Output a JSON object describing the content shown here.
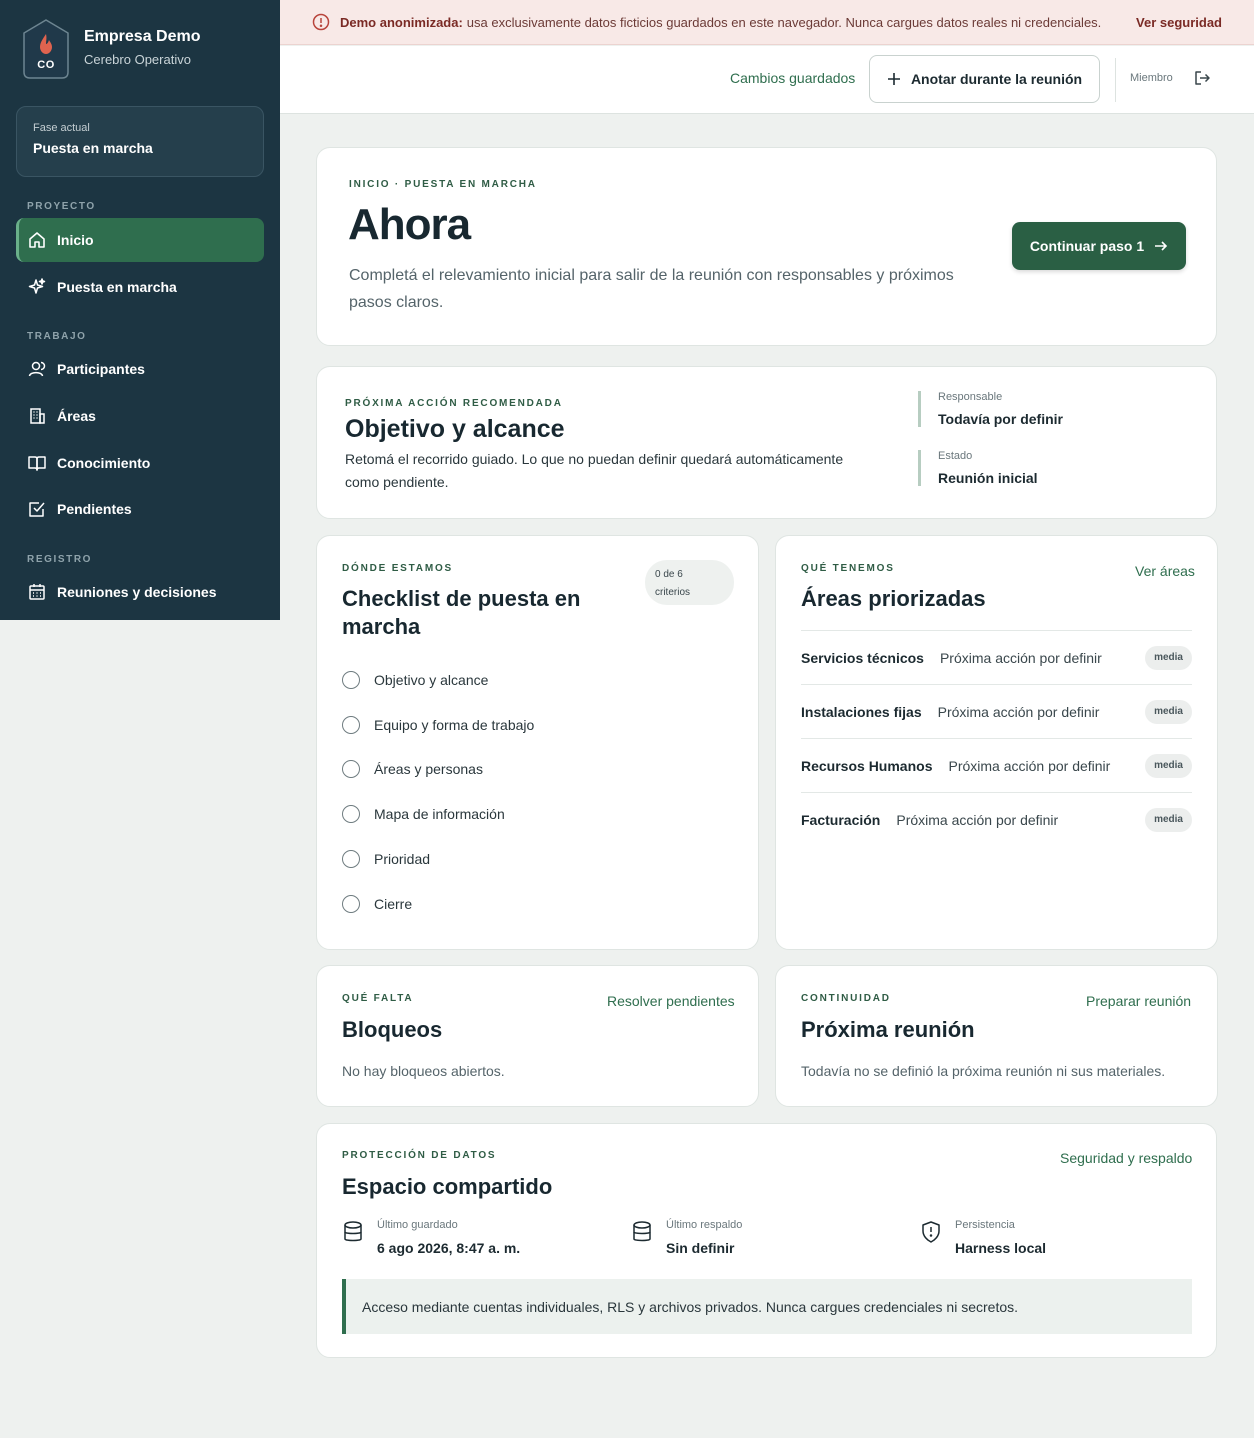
{
  "banner": {
    "bold": "Demo anonimizada:",
    "text": "usa exclusivamente datos ficticios guardados en este navegador. Nunca cargues datos reales ni credenciales.",
    "link": "Ver seguridad"
  },
  "brand": {
    "initials": "CO",
    "name": "Empresa Demo",
    "subtitle": "Cerebro Operativo"
  },
  "phase": {
    "label": "Fase actual",
    "value": "Puesta en marcha"
  },
  "sidebar": {
    "sections": [
      {
        "label": "PROYECTO",
        "items": [
          {
            "label": "Inicio",
            "icon": "home-icon",
            "active": true
          },
          {
            "label": "Puesta en marcha",
            "icon": "sparkles-icon"
          }
        ]
      },
      {
        "label": "TRABAJO",
        "items": [
          {
            "label": "Participantes",
            "icon": "user-icon"
          },
          {
            "label": "Áreas",
            "icon": "building-icon"
          },
          {
            "label": "Conocimiento",
            "icon": "book-icon"
          },
          {
            "label": "Pendientes",
            "icon": "checkbox-icon"
          }
        ]
      },
      {
        "label": "REGISTRO",
        "items": [
          {
            "label": "Reuniones y decisiones",
            "icon": "calendar-icon"
          }
        ]
      }
    ]
  },
  "topbar": {
    "saved": "Cambios guardados",
    "annotate": "Anotar durante la reunión",
    "role": "Miembro"
  },
  "hero": {
    "kicker": "INICIO · PUESTA EN MARCHA",
    "title": "Ahora",
    "description": "Completá el relevamiento inicial para salir de la reunión con responsables y próximos pasos claros.",
    "cta": "Continuar paso 1"
  },
  "next_action": {
    "kicker": "PRÓXIMA ACCIÓN RECOMENDADA",
    "title": "Objetivo y alcance",
    "description": "Retomá el recorrido guiado. Lo que no puedan definir quedará automáticamente como pendiente.",
    "owner_label": "Responsable",
    "owner_value": "Todavía por definir",
    "status_label": "Estado",
    "status_value": "Reunión inicial"
  },
  "checklist": {
    "kicker": "DÓNDE ESTAMOS",
    "title": "Checklist de puesta en marcha",
    "pill_line1": "0 de 6",
    "pill_line2": "criterios",
    "items": [
      "Objetivo y alcance",
      "Equipo y forma de trabajo",
      "Áreas y personas",
      "Mapa de información",
      "Prioridad",
      "Cierre"
    ]
  },
  "areas": {
    "kicker": "QUÉ TENEMOS",
    "title": "Áreas priorizadas",
    "link": "Ver áreas",
    "rows": [
      {
        "name": "Servicios técnicos",
        "action": "Próxima acción por definir",
        "badge": "media"
      },
      {
        "name": "Instalaciones fijas",
        "action": "Próxima acción por definir",
        "badge": "media"
      },
      {
        "name": "Recursos Humanos",
        "action": "Próxima acción por definir",
        "badge": "media"
      },
      {
        "name": "Facturación",
        "action": "Próxima acción por definir",
        "badge": "media"
      }
    ]
  },
  "blocks": {
    "kicker": "QUÉ FALTA",
    "title": "Bloqueos",
    "link": "Resolver pendientes",
    "description": "No hay bloqueos abiertos."
  },
  "meeting": {
    "kicker": "CONTINUIDAD",
    "title": "Próxima reunión",
    "link": "Preparar reunión",
    "description": "Todavía no se definió la próxima reunión ni sus materiales."
  },
  "data_protection": {
    "kicker": "PROTECCIÓN DE DATOS",
    "title": "Espacio compartido",
    "link": "Seguridad y respaldo",
    "items": [
      {
        "label": "Último guardado",
        "value": "6 ago 2026, 8:47 a. m.",
        "icon": "database-icon"
      },
      {
        "label": "Último respaldo",
        "value": "Sin definir",
        "icon": "database-icon"
      },
      {
        "label": "Persistencia",
        "value": "Harness local",
        "icon": "shield-icon"
      }
    ],
    "notice": "Acceso mediante cuentas individuales, RLS y archivos privados. Nunca cargues credenciales ni secretos."
  },
  "colors": {
    "sidebar": "#1c3542",
    "accent": "#2f6e4e",
    "banner": "#f8e9e7"
  }
}
